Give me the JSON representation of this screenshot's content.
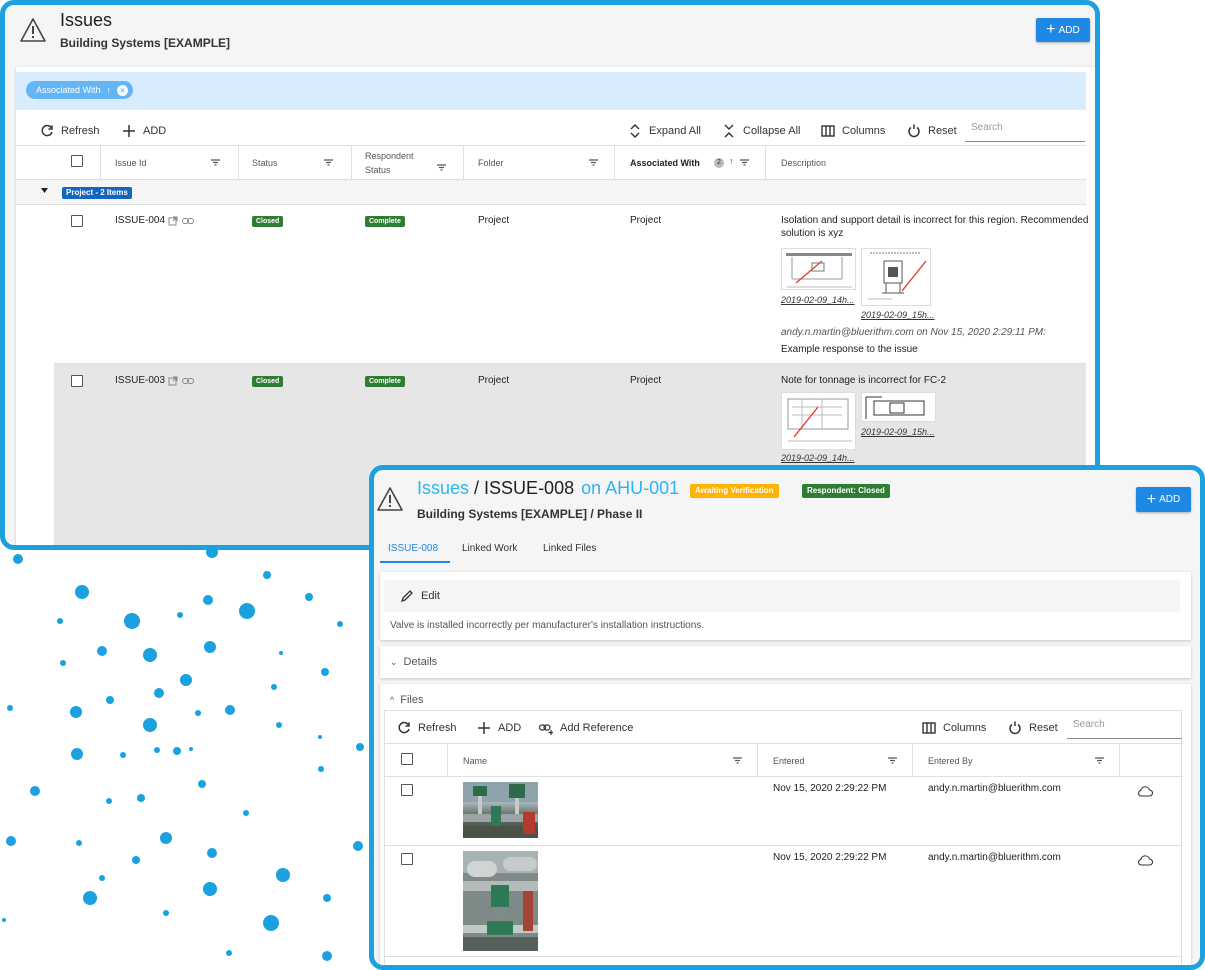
{
  "colors": {
    "accent": "#1ba1df",
    "link": "#29b6f6",
    "add_button": "#1e88e5",
    "closed_badge": "#2e7d32",
    "group_badge": "#1565c0",
    "awaiting_badge": "#ffb300"
  },
  "back_window": {
    "icon": "warning-icon",
    "title": "Issues",
    "subtitle": "Building Systems [EXAMPLE]",
    "add_label": "ADD",
    "group_chip": {
      "label": "Associated With",
      "sort_icon": "arrow-up-icon",
      "remove_icon": "close-circle-icon"
    },
    "toolbar": {
      "refresh": "Refresh",
      "add": "ADD",
      "expand_all": "Expand All",
      "collapse_all": "Collapse All",
      "columns": "Columns",
      "reset": "Reset",
      "search_placeholder": "Search"
    },
    "columns": {
      "issue_id": "Issue Id",
      "status": "Status",
      "respondent_status_1": "Respondent",
      "respondent_status_2": "Status",
      "folder": "Folder",
      "associated_with": "Associated With",
      "associated_with_count": "2",
      "description": "Description"
    },
    "group_label": "Project - 2 Items",
    "rows": [
      {
        "issue_id": "ISSUE-004",
        "status": "Closed",
        "respondent_status": "Complete",
        "folder": "Project",
        "associated_with": "Project",
        "description_1": "Isolation and support detail is incorrect for this region. Recommended",
        "description_2": "solution is xyz",
        "attachment_1": "2019-02-09_14h...",
        "attachment_2": "2019-02-09_15h...",
        "response_meta": "andy.n.martin@bluerithm.com on Nov 15, 2020 2:29:11 PM:",
        "response_text": "Example response to the issue"
      },
      {
        "issue_id": "ISSUE-003",
        "status": "Closed",
        "respondent_status": "Complete",
        "folder": "Project",
        "associated_with": "Project",
        "description_1": "Note for tonnage is incorrect for FC-2",
        "attachment_1": "2019-02-09_15h...",
        "attachment_2": "2019-02-09_14h..."
      }
    ]
  },
  "front_window": {
    "icon": "warning-icon",
    "breadcrumb_root": "Issues",
    "breadcrumb_sep": "/",
    "issue_id": "ISSUE-008",
    "on_target": "on AHU-001",
    "badge_awaiting": "Awaiting Verification",
    "badge_respondent": "Respondent: Closed",
    "subtitle": "Building Systems [EXAMPLE] / Phase II",
    "add_label": "ADD",
    "tabs": [
      "ISSUE-008",
      "Linked Work",
      "Linked Files"
    ],
    "edit_label": "Edit",
    "description": "Valve is installed incorrectly per manufacturer's installation instructions.",
    "details_label": "Details",
    "files_label": "Files",
    "files_toolbar": {
      "refresh": "Refresh",
      "add": "ADD",
      "add_reference": "Add Reference",
      "columns": "Columns",
      "reset": "Reset",
      "search_placeholder": "Search"
    },
    "files_columns": {
      "name": "Name",
      "entered": "Entered",
      "entered_by": "Entered By"
    },
    "files": [
      {
        "entered": "Nov 15, 2020 2:29:22 PM",
        "entered_by": "andy.n.martin@bluerithm.com",
        "icon": "cloud-icon"
      },
      {
        "entered": "Nov 15, 2020 2:29:22 PM",
        "entered_by": "andy.n.martin@bluerithm.com",
        "icon": "cloud-icon"
      }
    ]
  }
}
